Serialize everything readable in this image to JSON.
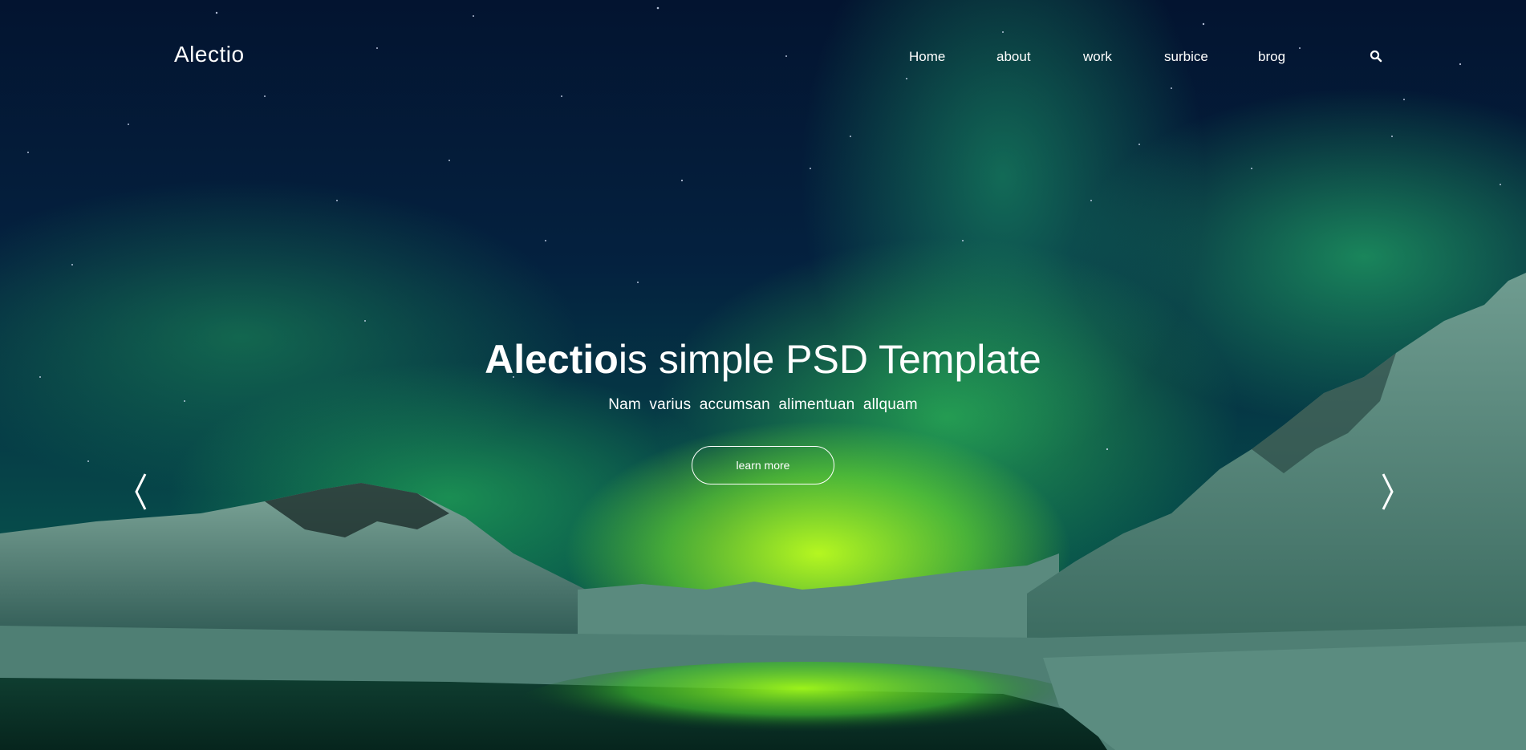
{
  "brand": {
    "logo": "Alectio"
  },
  "nav": {
    "items": [
      {
        "label": "Home"
      },
      {
        "label": "about"
      },
      {
        "label": "work"
      },
      {
        "label": "surbice"
      },
      {
        "label": "brog"
      }
    ],
    "search_icon": "search-icon"
  },
  "hero": {
    "title_bold": "Alectio",
    "title_rest": "is simple PSD Template",
    "subtitle": "Nam  varius  accumsan  alimentuan  allquam",
    "cta_label": "learn more",
    "prev_icon": "chevron-left-icon",
    "next_icon": "chevron-right-icon"
  },
  "colors": {
    "sky_top": "#031430",
    "aurora_green": "#3ae05a",
    "aurora_glow": "#b8ff1e",
    "text": "#ffffff"
  }
}
